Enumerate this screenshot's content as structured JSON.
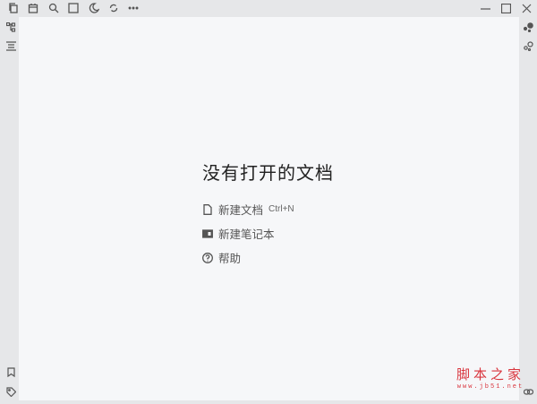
{
  "toolbar": {
    "icons": [
      "files-icon",
      "calendar-icon",
      "search-icon",
      "readonly-icon",
      "moon-icon",
      "sync-icon",
      "more-icon"
    ]
  },
  "empty_state": {
    "title": "没有打开的文档",
    "new_doc_label": "新建文档",
    "new_doc_shortcut": "Ctrl+N",
    "new_notebook_label": "新建笔记本",
    "help_label": "帮助"
  },
  "watermark": {
    "line1": "脚本之家",
    "line2": "www.jb51.net"
  }
}
